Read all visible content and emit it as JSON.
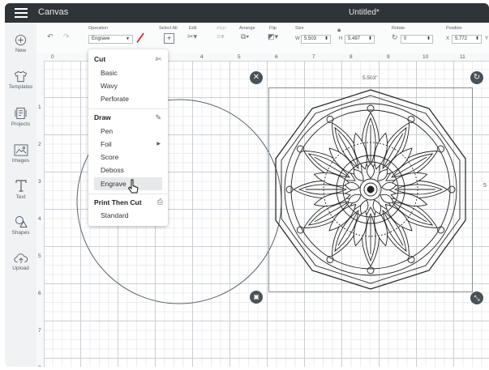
{
  "app": {
    "title": "Canvas",
    "doc_title": "Untitled*"
  },
  "leftbar": {
    "items": [
      {
        "label": "New",
        "icon": "plus-circle-icon"
      },
      {
        "label": "Templates",
        "icon": "shirt-icon"
      },
      {
        "label": "Projects",
        "icon": "projects-icon"
      },
      {
        "label": "Images",
        "icon": "image-icon"
      },
      {
        "label": "Text",
        "icon": "text-icon"
      },
      {
        "label": "Shapes",
        "icon": "shapes-icon"
      },
      {
        "label": "Upload",
        "icon": "upload-cloud-icon"
      }
    ]
  },
  "toolbar": {
    "operation_label": "Operation",
    "operation_value": "Engrave",
    "select_all_label": "Select All",
    "edit_label": "Edit",
    "align_label": "Align",
    "arrange_label": "Arrange",
    "flip_label": "Flip",
    "size_label": "Size",
    "w_label": "W",
    "w_value": "5.503",
    "h_label": "H",
    "h_value": "5.497",
    "rotate_label": "Rotate",
    "rotate_value": "0",
    "position_label": "Position",
    "x_label": "X",
    "x_value": "5.772",
    "y_label": "Y"
  },
  "ruler": {
    "top": [
      "0",
      "1",
      "2",
      "3",
      "4",
      "5",
      "6",
      "7",
      "8",
      "9",
      "10",
      "11"
    ],
    "left": [
      "1",
      "2",
      "3",
      "4",
      "5",
      "6",
      "7",
      "8"
    ]
  },
  "dropdown": {
    "cut_header": "Cut",
    "cut_items": [
      "Basic",
      "Wavy",
      "Perforate"
    ],
    "draw_header": "Draw",
    "draw_items": [
      "Pen",
      "Foil",
      "Score",
      "Deboss",
      "Engrave"
    ],
    "print_header": "Print Then Cut",
    "print_items": [
      "Standard"
    ],
    "highlighted": "Engrave"
  },
  "canvas": {
    "width_label": "5.503\"",
    "height_label": "5"
  },
  "colors": {
    "titlebar": "#2f3438",
    "accent_red": "#e0262f",
    "handle": "#4a5258"
  }
}
